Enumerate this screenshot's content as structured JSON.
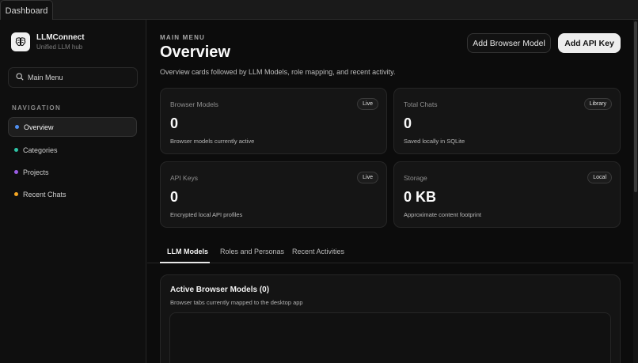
{
  "window": {
    "tab_label": "Dashboard"
  },
  "sidebar": {
    "brand_name": "LLMConnect",
    "brand_subtitle": "Unified LLM hub",
    "search_label": "Main Menu",
    "section_title": "NAVIGATION",
    "items": [
      {
        "label": "Overview",
        "color": "#4f8ff0",
        "active": true
      },
      {
        "label": "Categories",
        "color": "#2ec4a6",
        "active": false
      },
      {
        "label": "Projects",
        "color": "#9b5de5",
        "active": false
      },
      {
        "label": "Recent Chats",
        "color": "#f5a623",
        "active": false
      }
    ]
  },
  "header": {
    "eyebrow": "MAIN MENU",
    "title": "Overview",
    "description": "Overview cards followed by LLM Models, role mapping, and recent activity.",
    "add_browser_model_label": "Add Browser Model",
    "add_api_key_label": "Add API Key"
  },
  "cards": [
    {
      "label": "Browser Models",
      "badge": "Live",
      "value": "0",
      "description": "Browser models currently active"
    },
    {
      "label": "Total Chats",
      "badge": "Library",
      "value": "0",
      "description": "Saved locally in SQLite"
    },
    {
      "label": "API Keys",
      "badge": "Live",
      "value": "0",
      "description": "Encrypted local API profiles"
    },
    {
      "label": "Storage",
      "badge": "Local",
      "value": "0 KB",
      "description": "Approximate content footprint"
    }
  ],
  "content_tabs": [
    {
      "label": "LLM Models",
      "active": true
    },
    {
      "label": "Roles and Personas",
      "active": false
    },
    {
      "label": "Recent Activities",
      "active": false
    }
  ],
  "panel": {
    "title": "Active Browser Models (0)",
    "description": "Browser tabs currently mapped to the desktop app"
  }
}
